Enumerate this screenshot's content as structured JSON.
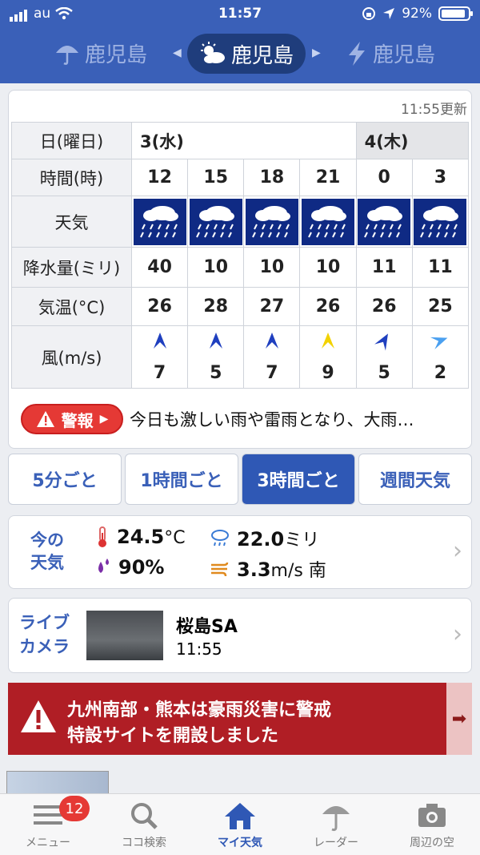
{
  "status_bar": {
    "carrier": "au",
    "time": "11:57",
    "battery": "92%",
    "battery_level": 0.92
  },
  "header": {
    "cities": [
      {
        "name": "鹿児島",
        "icon": "umbrella-icon"
      },
      {
        "name": "鹿児島",
        "icon": "sun-cloud-icon"
      },
      {
        "name": "鹿児島",
        "icon": "lightning-icon"
      }
    ]
  },
  "forecast": {
    "updated": "11:55更新",
    "labels": {
      "day": "日(曜日)",
      "time": "時間(時)",
      "weather": "天気",
      "precip": "降水量(ミリ)",
      "temp": "気温(°C)",
      "wind": "風(m/s)"
    },
    "days": [
      {
        "label": "3(水)"
      },
      {
        "label": "4(木)"
      }
    ],
    "hours": [
      "12",
      "15",
      "18",
      "21",
      "0",
      "3"
    ],
    "precip": [
      "40",
      "10",
      "10",
      "10",
      "11",
      "11"
    ],
    "temps": [
      "26",
      "28",
      "27",
      "26",
      "26",
      "25"
    ],
    "wind_speed": [
      "7",
      "5",
      "7",
      "9",
      "5",
      "2"
    ],
    "wind_colors": [
      "#1f3fbf",
      "#1f3fbf",
      "#1f3fbf",
      "#f2d200",
      "#1f3fbf",
      "#4aa0f0"
    ]
  },
  "warning": {
    "label": "警報",
    "text": "今日も激しい雨や雷雨となり、大雨…"
  },
  "tabs": [
    "5分ごと",
    "1時間ごと",
    "3時間ごと",
    "週間天気"
  ],
  "current": {
    "title_l1": "今の",
    "title_l2": "天気",
    "temp_value": "24.5",
    "temp_unit": "°C",
    "rain_value": "22.0",
    "rain_unit": "ミリ",
    "humidity": "90%",
    "wind_value": "3.3",
    "wind_unit": "m/s 南"
  },
  "live_camera": {
    "title_l1": "ライブ",
    "title_l2": "カメラ",
    "name": "桜島SA",
    "time": "11:55"
  },
  "banner": {
    "line1": "九州南部・熊本は豪雨災害に警戒",
    "line2": "特設サイトを開設しました"
  },
  "nav": {
    "items": [
      {
        "label": "メニュー",
        "icon": "menu-icon",
        "badge": "12"
      },
      {
        "label": "ココ検索",
        "icon": "search-icon"
      },
      {
        "label": "マイ天気",
        "icon": "home-icon"
      },
      {
        "label": "レーダー",
        "icon": "radar-umbrella-icon"
      },
      {
        "label": "周辺の空",
        "icon": "camera-icon"
      }
    ]
  }
}
